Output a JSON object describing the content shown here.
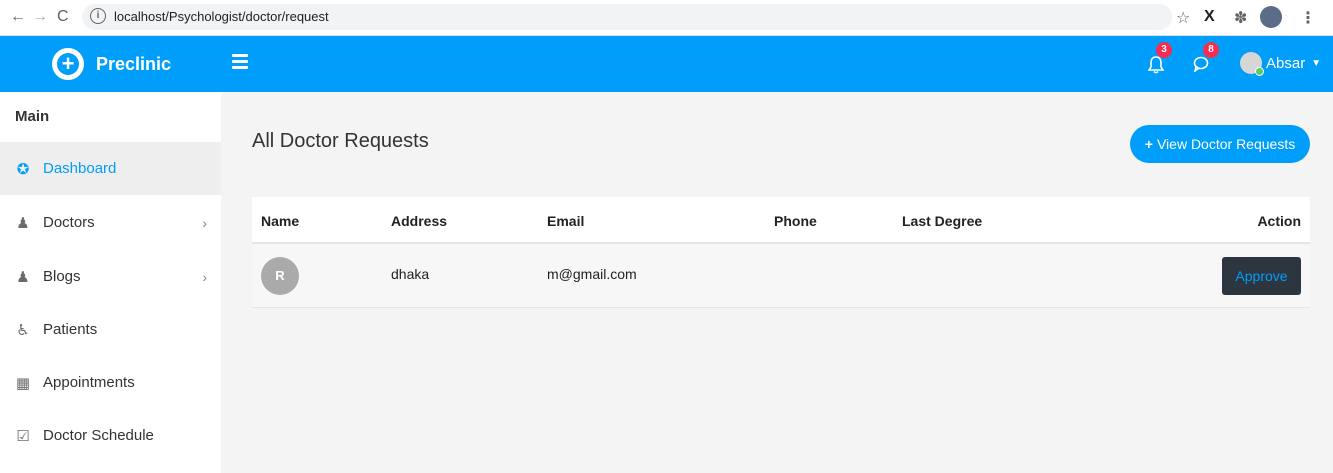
{
  "browser": {
    "url": "localhost/Psychologist/doctor/request",
    "back": "←",
    "forward": "→",
    "reload": "C",
    "info": "i",
    "star": "☆",
    "x": "X",
    "puzzle": "✽",
    "menu": "⋮"
  },
  "header": {
    "brand": "Preclinic",
    "notifications_count": "3",
    "messages_count": "8",
    "user_name": "Absar",
    "accent_color": "#009efb"
  },
  "sidebar": {
    "section": "Main",
    "items": [
      {
        "label": "Dashboard",
        "icon": "dashboard-icon",
        "glyph": "✪",
        "active": true
      },
      {
        "label": "Doctors",
        "icon": "user-md-icon",
        "glyph": "♟",
        "submenu": true
      },
      {
        "label": "Blogs",
        "icon": "user-icon",
        "glyph": "♟",
        "submenu": true
      },
      {
        "label": "Patients",
        "icon": "wheelchair-icon",
        "glyph": "♿"
      },
      {
        "label": "Appointments",
        "icon": "calendar-icon",
        "glyph": "▦"
      },
      {
        "label": "Doctor Schedule",
        "icon": "calendar-check-icon",
        "glyph": "☑"
      }
    ]
  },
  "main": {
    "title": "All Doctor Requests",
    "add_button": "View Doctor Requests",
    "table": {
      "columns": [
        "Name",
        "Address",
        "Email",
        "Phone",
        "Last Degree",
        "Action"
      ],
      "rows": [
        {
          "avatar_letter": "R",
          "name": "",
          "address": "dhaka",
          "email": "m@gmail.com",
          "phone": "",
          "last_degree": "",
          "action": "Approve"
        }
      ]
    }
  }
}
